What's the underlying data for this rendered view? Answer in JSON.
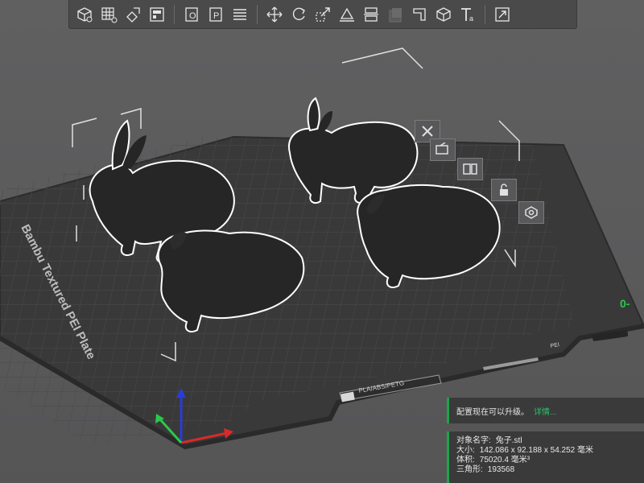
{
  "toolbar": {
    "items": [
      {
        "name": "add-object-icon"
      },
      {
        "name": "add-plate-icon"
      },
      {
        "name": "auto-orient-icon"
      },
      {
        "name": "arrange-icon"
      },
      {
        "name": "split-objects-icon"
      },
      {
        "name": "split-parts-icon"
      },
      {
        "name": "layers-icon"
      },
      {
        "name": "move-icon"
      },
      {
        "name": "rotate-icon"
      },
      {
        "name": "scale-icon"
      },
      {
        "name": "lay-on-face-icon"
      },
      {
        "name": "cut-icon"
      },
      {
        "name": "support-paint-icon"
      },
      {
        "name": "seam-paint-icon"
      },
      {
        "name": "color-paint-icon"
      },
      {
        "name": "text-icon"
      },
      {
        "name": "assembly-view-icon"
      }
    ]
  },
  "plate": {
    "label": "Bambu Textured PEI Plate",
    "badge_left": "PLA/ABS/PETG",
    "badge_right": "PEI"
  },
  "side_tools": [
    "delete-icon",
    "orient-icon",
    "arrange-icon",
    "lock-icon",
    "settings-icon"
  ],
  "notice": {
    "text": "配置现在可以升级。",
    "link": "详情..."
  },
  "object_info": {
    "name_label": "对象名字:",
    "name_value": "兔子.stl",
    "size_label": "大小:",
    "size_value": "142.086 x 92.188 x 54.252 毫米",
    "volume_label": "体积:",
    "volume_value": "75020.4 毫米³",
    "triangles_label": "三角形:",
    "triangles_value": "193568"
  },
  "colors": {
    "accent_green": "#1fa34a",
    "panel_bg": "#3a3a3b",
    "plate": "#39393a",
    "bunny": "#252526"
  }
}
